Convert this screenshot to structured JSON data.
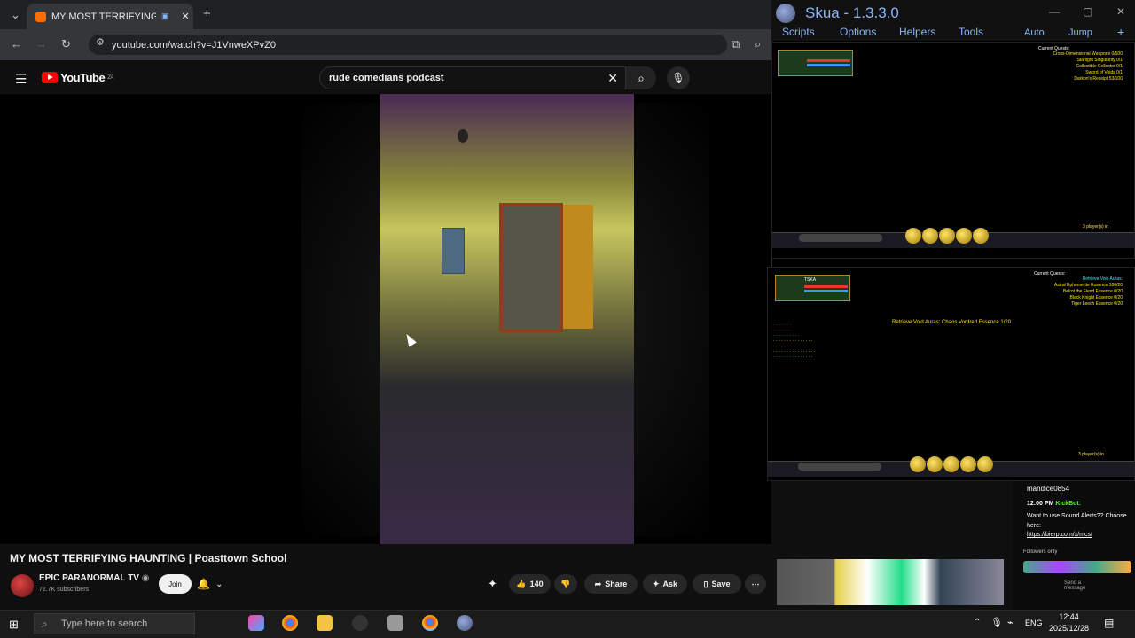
{
  "browser": {
    "tab_title": "MY MOST TERRIFYING HAUNTING",
    "new_tab": "+",
    "url": "youtube.com/watch?v=J1VnweXPvZ0"
  },
  "youtube": {
    "logo": "YouTube",
    "region": "ZA",
    "search_value": "rude comedians podcast",
    "video_title": "MY MOST TERRIFYING HAUNTING | Poasttown School",
    "channel": "EPIC PARANORMAL TV",
    "subscribers": "72.7K subscribers",
    "join_label": "Join",
    "likes": "140",
    "share_label": "Share",
    "ask_label": "Ask",
    "save_label": "Save"
  },
  "skua": {
    "title": "Skua - 1.3.3.0",
    "menu": [
      "Scripts",
      "Options",
      "Helpers",
      "Tools"
    ],
    "menu_right": [
      "Auto",
      "Jump"
    ],
    "quests_header": "Current Quests:",
    "pane1_quests": [
      "Cross-Dimensional Weapons 0/500",
      "Starlight Singularity 0/1",
      "Collectible Collector 0/1",
      "Sword of Voids 0/1",
      "Darkon's Receipt 53/100"
    ],
    "pane2_quests": [
      "Retrieve Void Auras:",
      "Astral Ephemerite Essence 100/20",
      "Belrot the Fiend Essence 0/20",
      "Black Knight Essence 0/20",
      "Tiger Leech Essence 0/20"
    ],
    "pane2_banner": "Retrieve Void Auras: Chaos Vordred Essence 1/20",
    "pane2_hud": "TSKA",
    "players_label": "3 player(s) in"
  },
  "kick_chat": {
    "user": "mandice0854",
    "time": "12:00 PM",
    "bot": "KickBot:",
    "message": "Want to use Sound Alerts?? Choose here:",
    "link": "https://bierp.com/x/mcst",
    "followers_only": "Followers only",
    "send_placeholder": "Send a message"
  },
  "taskbar": {
    "search_placeholder": "Type here to search",
    "language": "ENG",
    "time": "12:44",
    "date": "2025/12/28"
  },
  "colors": {
    "youtube_red": "#ff0000",
    "skua_blue": "#8ab4f8",
    "kick_green": "#53fc18"
  }
}
